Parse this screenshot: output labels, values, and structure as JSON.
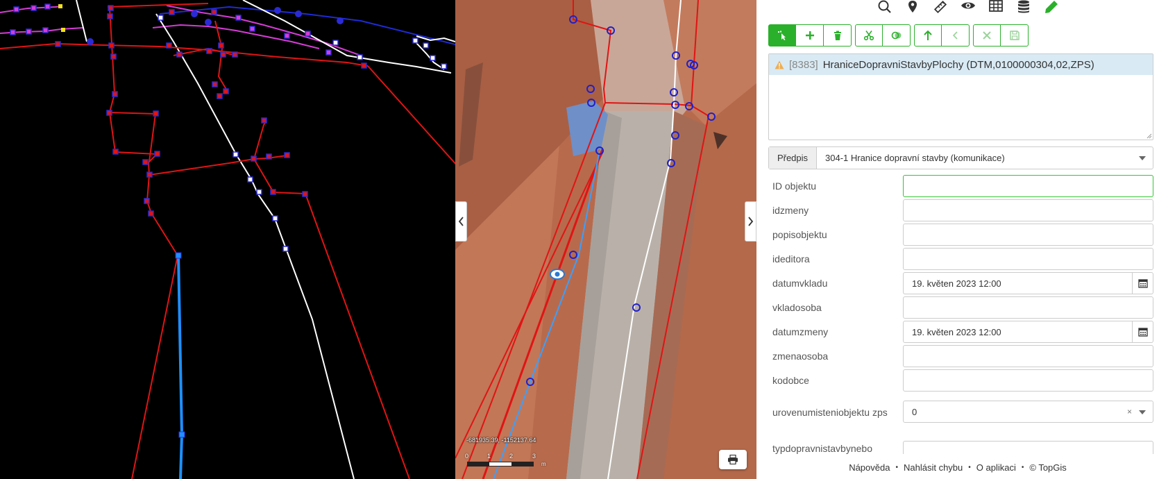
{
  "ortho": {
    "coordinates": "-681935.39, -1152137.64",
    "scale": {
      "ticks": [
        "0",
        "1",
        "2",
        "3"
      ],
      "unit": "m"
    }
  },
  "toolbar": {
    "top_icons": [
      "search-icon",
      "location-pin-icon",
      "measure-icon",
      "eye-icon",
      "table-icon",
      "database-icon",
      "pencil-icon"
    ],
    "edit_buttons": [
      "select-icon",
      "plus-icon",
      "trash-icon",
      "scissors-icon",
      "merge-icon",
      "arrow-up-icon",
      "chevron-left-icon",
      "close-icon",
      "save-icon"
    ],
    "accent_color": "#2bb02b"
  },
  "feature": {
    "id": "[8383]",
    "name": "HraniceDopravniStavbyPlochy (DTM,0100000304,02,ZPS)"
  },
  "predpis": {
    "label": "Předpis",
    "value": "304-1 Hranice dopravní stavby (komunikace)"
  },
  "form": {
    "fields": [
      {
        "label": "ID objektu",
        "value": ""
      },
      {
        "label": "idzmeny",
        "value": ""
      },
      {
        "label": "popisobjektu",
        "value": ""
      },
      {
        "label": "ideditora",
        "value": ""
      },
      {
        "label": "datumvkladu",
        "value": "19. květen 2023 12:00"
      },
      {
        "label": "vkladosoba",
        "value": ""
      },
      {
        "label": "datumzmeny",
        "value": "19. květen 2023 12:00"
      },
      {
        "label": "zmenaosoba",
        "value": ""
      },
      {
        "label": "kodobce",
        "value": ""
      },
      {
        "label": "urovenumisteniobjektu zps",
        "value": "0",
        "clear": "×"
      },
      {
        "label": "typdopravnistavbynebo",
        "value": ""
      }
    ]
  },
  "footer": {
    "links": [
      "Nápověda",
      "Nahlásit chybu",
      "O aplikaci",
      "© TopGis"
    ],
    "separator": "•"
  }
}
